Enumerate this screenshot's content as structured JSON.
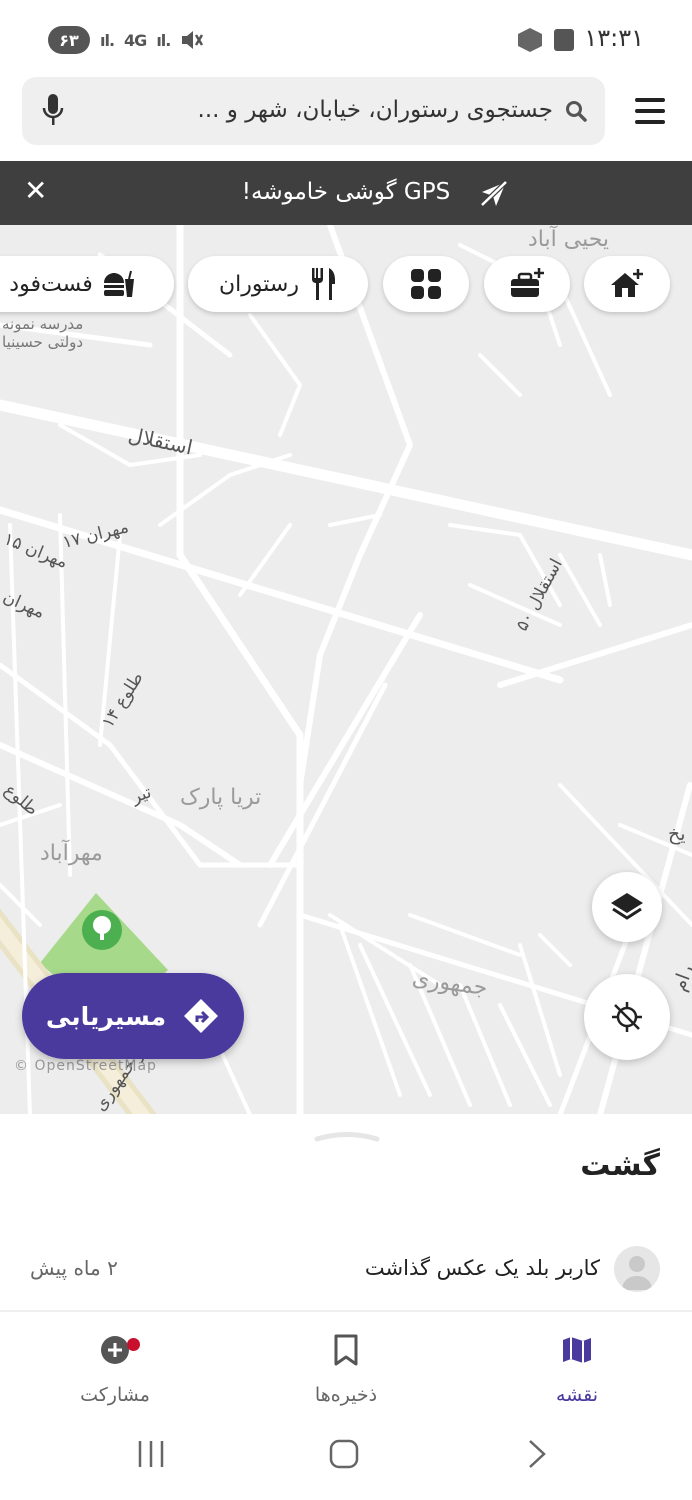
{
  "status_bar": {
    "time": "۱۳:۳۱",
    "battery": "۶۳",
    "signal_text": "4G"
  },
  "search": {
    "placeholder": "جستجوی رستوران، خیابان، شهر و ..."
  },
  "gps_banner": {
    "message": "GPS گوشی خاموشه!"
  },
  "chips": {
    "restaurant": "رستوران",
    "fastfood": "فست‌فود"
  },
  "map": {
    "labels": {
      "yahya_abad": "یحیی آباد",
      "school_1": "مدرسه نمونه",
      "school_2": "دولتی حسینیا",
      "esteghlal": "استقلال",
      "mehran17": "مهران ۱۷",
      "mehran15": "مهران ۱۵",
      "mehran_x": "مهران",
      "esteghlal50": "استقلال ۵۰",
      "tolou14": "طلوع ۱۴",
      "tolou": "طلوع",
      "tir": "تیر",
      "soraya_park": "تریا پارک",
      "mehrabad": "مهرآباد",
      "jomhouri": "جمهوری",
      "blvd": "بلوار جمهوری",
      "edge_kh": "یخ",
      "edge_ram": "رام"
    },
    "credit": "© OpenStreetMap"
  },
  "route_button": {
    "label": "مسیریابی"
  },
  "sheet": {
    "title": "گشت",
    "activity_text": "کاربر بلد یک عکس گذاشت",
    "activity_time": "۲ ماه پیش"
  },
  "bottom_nav": {
    "map": "نقشه",
    "saved": "ذخیره‌ها",
    "contribute": "مشارکت"
  },
  "colors": {
    "accent": "#4a3a9e",
    "banner": "#3f3f3f",
    "map_bg": "#ededed",
    "park": "#a6d98a",
    "notification": "#c8102e"
  }
}
